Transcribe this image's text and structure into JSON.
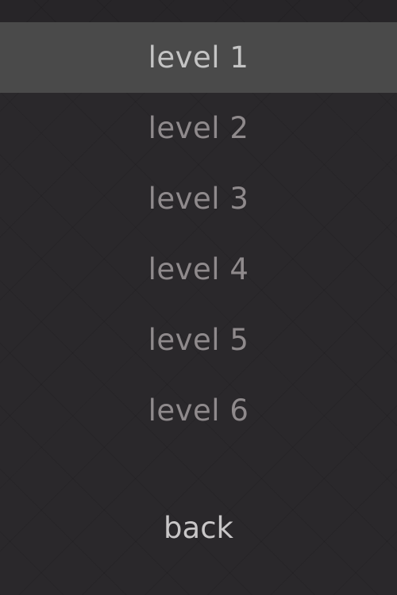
{
  "menu": {
    "items": [
      {
        "label": "level 1",
        "selected": true
      },
      {
        "label": "level 2",
        "selected": false
      },
      {
        "label": "level 3",
        "selected": false
      },
      {
        "label": "level 4",
        "selected": false
      },
      {
        "label": "level 5",
        "selected": false
      },
      {
        "label": "level 6",
        "selected": false
      }
    ],
    "back_label": "back"
  },
  "colors": {
    "background": "#2a282b",
    "selected_row": "#4a4a4a",
    "item_text": "#8f8a8c",
    "selected_text": "#c4c4c4",
    "back_text": "#c8c6c7"
  }
}
